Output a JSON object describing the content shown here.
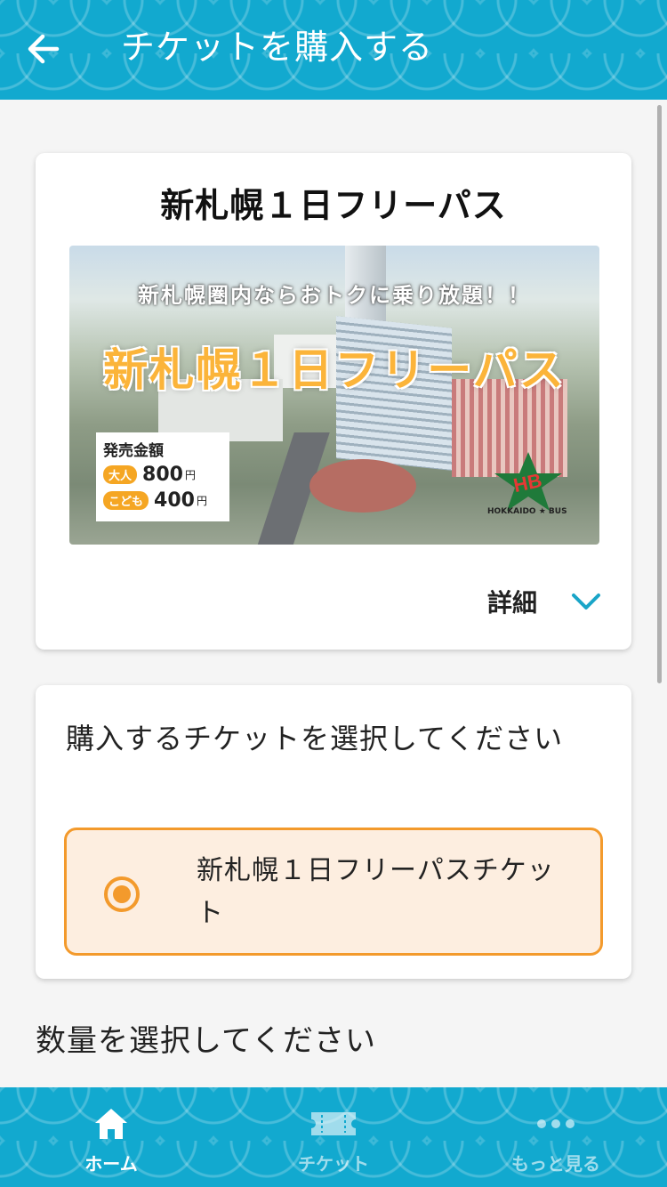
{
  "header": {
    "title": "チケットを購入する",
    "back_icon": "arrow-left-icon"
  },
  "pass_card": {
    "title": "新札幌１日フリーパス",
    "banner": {
      "subtitle": "新札幌圏内ならおトクに乗り放題！！",
      "headline": "新札幌１日フリーパス",
      "price_title": "発売金額",
      "prices": [
        {
          "tag": "大人",
          "value": "800",
          "unit": "円"
        },
        {
          "tag": "こども",
          "value": "400",
          "unit": "円"
        }
      ],
      "logo_text": "HB",
      "logo_caption": "HOKKAIDO ★ BUS"
    },
    "detail_label": "詳細",
    "detail_icon": "chevron-down-icon"
  },
  "select_card": {
    "heading": "購入するチケットを選択してください",
    "option_label": "新札幌１日フリーパスチケット",
    "option_selected": true
  },
  "quantity": {
    "heading": "数量を選択してください"
  },
  "tabbar": {
    "items": [
      {
        "label": "ホーム",
        "icon": "home-icon",
        "active": true
      },
      {
        "label": "チケット",
        "icon": "ticket-icon",
        "active": false
      },
      {
        "label": "もっと見る",
        "icon": "more-icon",
        "active": false
      }
    ]
  },
  "colors": {
    "primary": "#12a9cf",
    "accent": "#f39a2c",
    "selected_bg": "#fdeee0"
  }
}
